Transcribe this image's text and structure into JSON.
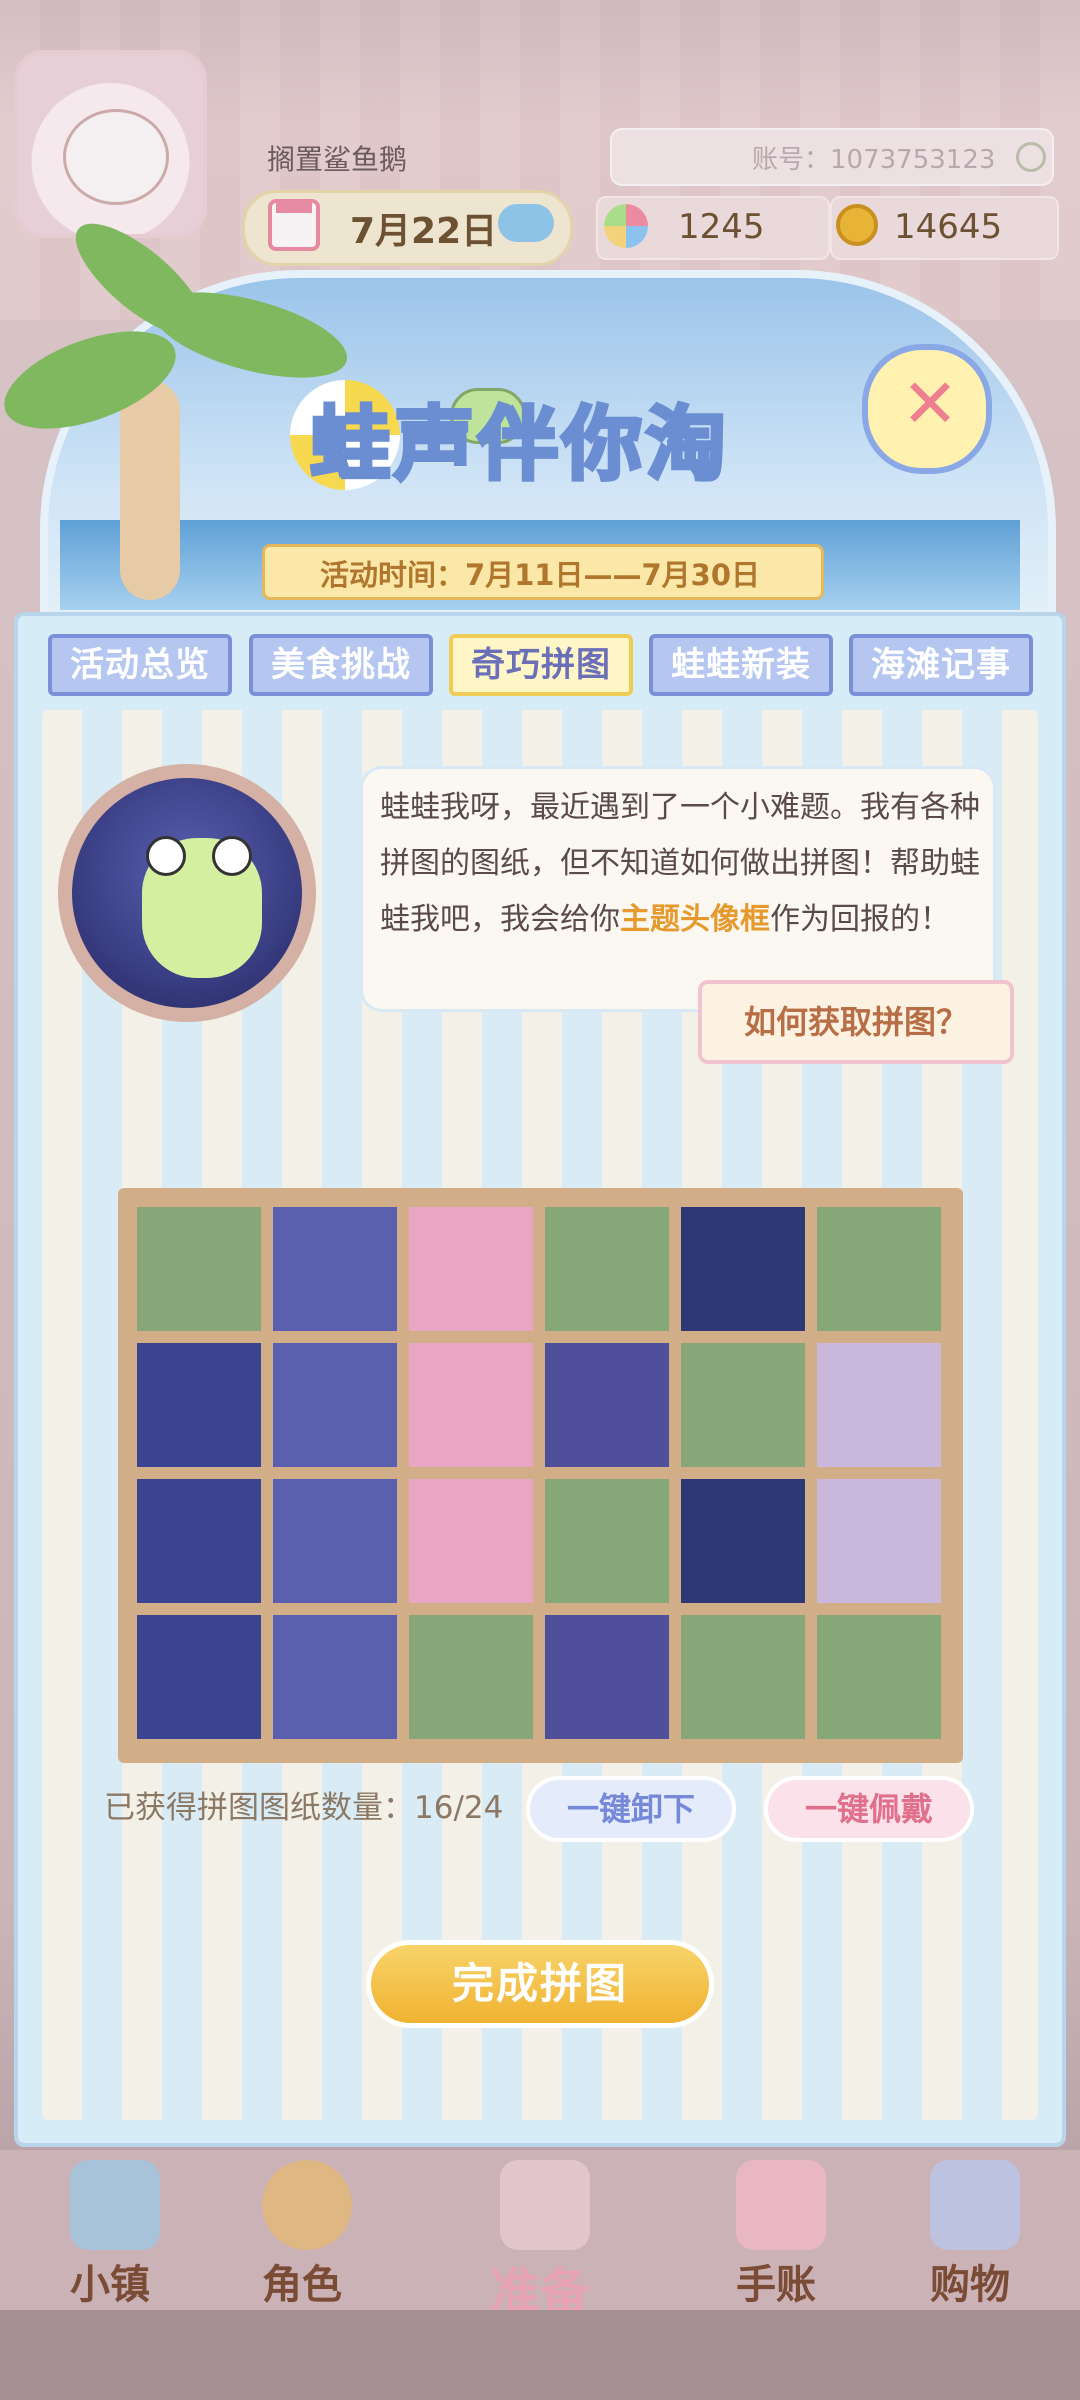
{
  "header": {
    "username": "搁置鲨鱼鹅",
    "account_label": "账号：1073753123",
    "date": "7月22日",
    "gems": "1245",
    "coins": "14645"
  },
  "banner": {
    "title": "蛙声伴你淘",
    "period": "活动时间：7月11日——7月30日"
  },
  "tabs": [
    {
      "label": "活动总览"
    },
    {
      "label": "美食挑战"
    },
    {
      "label": "奇巧拼图"
    },
    {
      "label": "蛙蛙新装"
    },
    {
      "label": "海滩记事"
    }
  ],
  "active_tab": "奇巧拼图",
  "dialog": {
    "text_before": "蛙蛙我呀，最近遇到了一个小难题。我有各种拼图的图纸，但不知道如何做出拼图！帮助蛙蛙我吧，我会给你",
    "highlight": "主题头像框",
    "text_after": "作为回报的！",
    "help_button": "如何获取拼图？"
  },
  "puzzle": {
    "grid": [
      [
        0,
        1,
        1,
        0,
        1,
        0
      ],
      [
        1,
        1,
        1,
        1,
        0,
        1
      ],
      [
        1,
        1,
        1,
        0,
        1,
        1
      ],
      [
        1,
        1,
        0,
        1,
        0,
        0
      ]
    ],
    "count_text": "已获得拼图图纸数量：16/24",
    "unequip_label": "一键卸下",
    "equip_label": "一键佩戴",
    "complete_label": "完成拼图"
  },
  "nav": [
    {
      "label": "小镇",
      "icon": "map-icon"
    },
    {
      "label": "角色",
      "icon": "character-icon"
    },
    {
      "label": "准备",
      "icon": "prepare-icon"
    },
    {
      "label": "手账",
      "icon": "journal-icon"
    },
    {
      "label": "购物",
      "icon": "shopping-bag-icon"
    }
  ],
  "colors": {
    "tab_border": "#7a8fd8",
    "active_tab_border": "#f0cb56",
    "empty_cell": "#86a777",
    "highlight": "#e69a2e"
  }
}
